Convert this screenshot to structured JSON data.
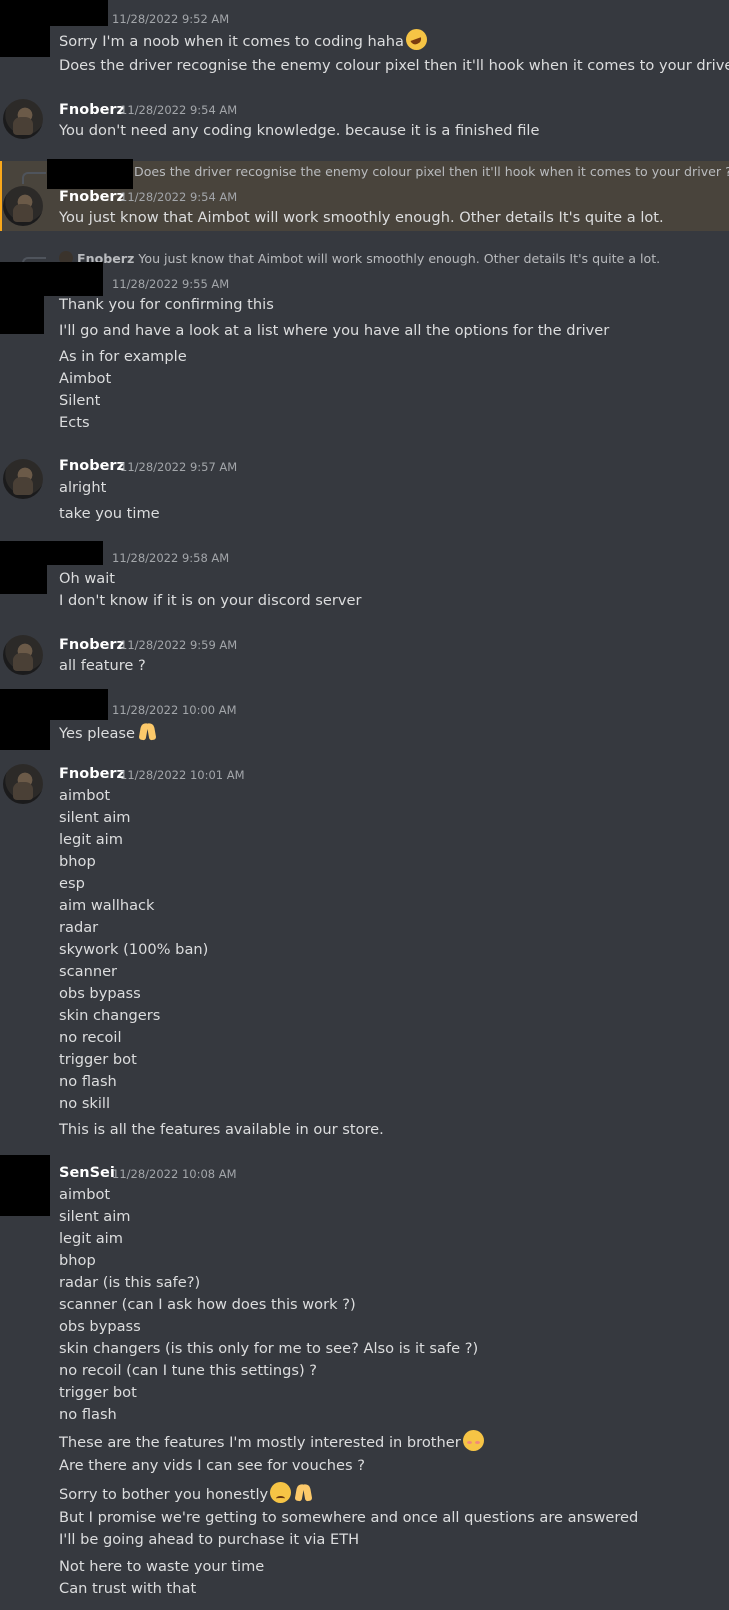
{
  "users": {
    "fnoberz": "Fnoberz",
    "sensei": "SenSei"
  },
  "m1": {
    "timestamp": "11/28/2022 9:52 AM",
    "lines": [
      "Sorry I'm a noob when it comes to coding haha",
      "Does the driver recognise the enemy colour pixel then it'll hook when it comes to your driver ?"
    ],
    "emoji": "rofl-emoji"
  },
  "m2": {
    "author": "Fnoberz",
    "timestamp": "11/28/2022 9:54 AM",
    "lines": [
      "You don't need any coding knowledge. because it is a finished file"
    ]
  },
  "m3": {
    "reply_text": "Does the driver recognise the enemy colour pixel then it'll hook when it comes to your driver ?",
    "author": "Fnoberz",
    "timestamp": "11/28/2022 9:54 AM",
    "lines": [
      "You just know that Aimbot will work smoothly enough. Other details It's quite a lot."
    ]
  },
  "m4": {
    "reply_author": "Fnoberz",
    "reply_text": "You just know that Aimbot will work smoothly enough. Other details It's quite a lot.",
    "timestamp": "11/28/2022 9:55 AM",
    "lines": [
      "Thank you for confirming this",
      "I'll go and have a look at a list where you have all the options for the driver",
      "As in for example",
      "Aimbot",
      "Silent",
      "Ects"
    ]
  },
  "m5": {
    "author": "Fnoberz",
    "timestamp": "11/28/2022 9:57 AM",
    "lines": [
      "alright",
      "take you time"
    ]
  },
  "m6": {
    "timestamp": "11/28/2022 9:58 AM",
    "lines": [
      "Oh wait",
      "I don't know if it is on your discord server"
    ]
  },
  "m7": {
    "author": "Fnoberz",
    "timestamp": "11/28/2022 9:59 AM",
    "lines": [
      "all feature ?"
    ]
  },
  "m8": {
    "timestamp": "11/28/2022 10:00 AM",
    "lines": [
      "Yes please"
    ],
    "emoji": "pray-emoji"
  },
  "m9": {
    "author": "Fnoberz",
    "timestamp": "11/28/2022 10:01 AM",
    "lines": [
      "aimbot",
      "silent aim",
      "legit aim",
      "bhop",
      "esp",
      "aim wallhack",
      "radar",
      "skywork (100% ban)",
      "scanner",
      "obs bypass",
      "skin changers",
      "no recoil",
      "trigger bot",
      "no flash",
      "no skill",
      "This is all the features available in our store."
    ]
  },
  "m10": {
    "author": "SenSei",
    "timestamp": "11/28/2022 10:08 AM",
    "lines": [
      "aimbot",
      "silent aim",
      "legit aim",
      "bhop",
      "radar (is this safe?)",
      "scanner (can I ask how does this work ?)",
      "obs bypass",
      "skin changers (is this only for me to see? Also is it safe ?)",
      "no recoil (can I tune this settings) ?",
      "trigger bot",
      "no flash",
      "These are the features I'm mostly interested in brother",
      "Are there any vids I can see for vouches ?",
      "Sorry to bother you honestly",
      "But I promise we're getting to somewhere and once all questions are answered",
      "I'll be going ahead to purchase it via ETH",
      "Not here to waste your time",
      "Can trust with that"
    ]
  },
  "colors": {
    "background": "#36393f",
    "text": "#dcddde",
    "username": "#ffffff",
    "timestamp": "#a3a6aa",
    "reply_highlight": "#49443c"
  }
}
